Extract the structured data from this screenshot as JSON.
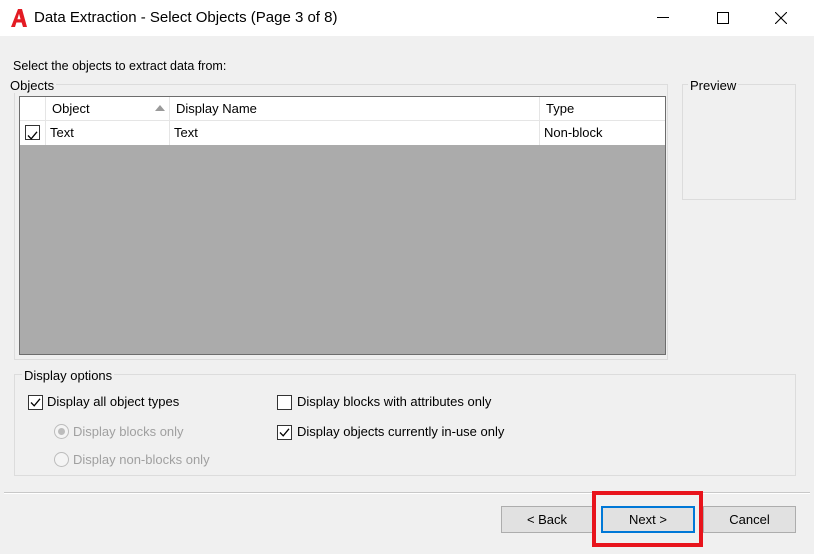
{
  "window": {
    "title": "Data Extraction - Select Objects (Page 3 of 8)",
    "accent_color": "#e31b23"
  },
  "instruction": "Select the objects to extract data from:",
  "objects": {
    "group_label": "Objects",
    "columns": [
      "Object",
      "Display Name",
      "Type"
    ],
    "rows": [
      {
        "checked": true,
        "object": "Text",
        "display_name": "Text",
        "type": "Non-block"
      }
    ]
  },
  "preview": {
    "label": "Preview"
  },
  "display_options": {
    "group_label": "Display options",
    "all_object_types": {
      "label": "Display all object types",
      "checked": true
    },
    "blocks_only": {
      "label": "Display blocks only",
      "selected": true,
      "enabled": false
    },
    "non_blocks_only": {
      "label": "Display non-blocks only",
      "selected": false,
      "enabled": false
    },
    "blocks_with_attributes": {
      "label": "Display blocks with attributes only",
      "checked": false
    },
    "currently_in_use": {
      "label": "Display objects currently in-use only",
      "checked": true
    }
  },
  "buttons": {
    "back": "< Back",
    "next": "Next >",
    "cancel": "Cancel"
  },
  "highlight_color": "#e8141c"
}
